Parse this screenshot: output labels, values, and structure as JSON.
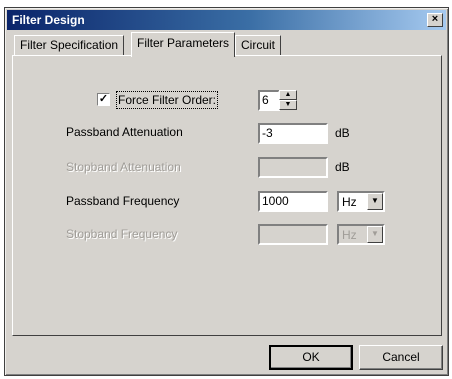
{
  "window": {
    "title": "Filter Design",
    "close_label": "×"
  },
  "tabs": [
    {
      "label": "Filter Specification"
    },
    {
      "label": "Filter Parameters"
    },
    {
      "label": "Circuit"
    }
  ],
  "params": {
    "force_order": {
      "label": "Force Filter Order:",
      "checked": true,
      "check_mark": "✓",
      "value": "6"
    },
    "passband_attenuation": {
      "label": "Passband Attenuation",
      "value": "-3",
      "unit": "dB"
    },
    "stopband_attenuation": {
      "label": "Stopband Attenuation",
      "value": "",
      "unit": "dB"
    },
    "passband_frequency": {
      "label": "Passband Frequency",
      "value": "1000",
      "unit": "Hz"
    },
    "stopband_frequency": {
      "label": "Stopband Frequency",
      "value": "",
      "unit": "Hz"
    }
  },
  "buttons": {
    "ok": "OK",
    "cancel": "Cancel"
  }
}
